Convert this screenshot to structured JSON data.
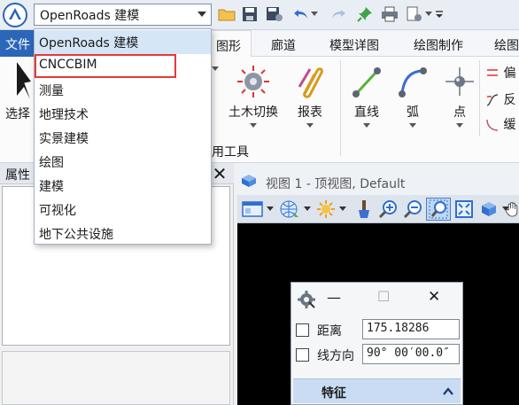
{
  "workflow": {
    "current": "OpenRoads 建模"
  },
  "dropdown": {
    "items": [
      "OpenRoads 建模",
      "CNCCBIM",
      "测量",
      "地理技术",
      "实景建模",
      "绘图",
      "建模",
      "可视化",
      "地下公共设施"
    ],
    "selected_index": 0,
    "highlighted_index": 1
  },
  "ribbon": {
    "file_tab": "文件",
    "tabs": [
      "图形",
      "廊道",
      "模型详图",
      "绘图制作",
      "绘图"
    ],
    "active_tab": "图形",
    "left_tool": "选择",
    "tools": [
      "土木切换",
      "报表",
      "直线",
      "弧",
      "点"
    ],
    "small_tools": [
      "偏",
      "反",
      "缓"
    ],
    "group_label": "用工具"
  },
  "properties": {
    "title": "属性",
    "close": "✕"
  },
  "view": {
    "title": "视图 1 - 顶视图, Default"
  },
  "accudraw": {
    "min": "—",
    "max": "☐",
    "close": "✕",
    "rows": [
      {
        "label": "距离",
        "value": "175.18286"
      },
      {
        "label": "线方向",
        "value": "90° 00′00.0″"
      }
    ],
    "section": "特征",
    "section_icon": "chevron-up-icon"
  },
  "colors": {
    "file_tab": "#2b66b8",
    "highlight_box": "#e53935",
    "selected_row": "#d5e6f7",
    "section_header": "#c9dcf3"
  }
}
